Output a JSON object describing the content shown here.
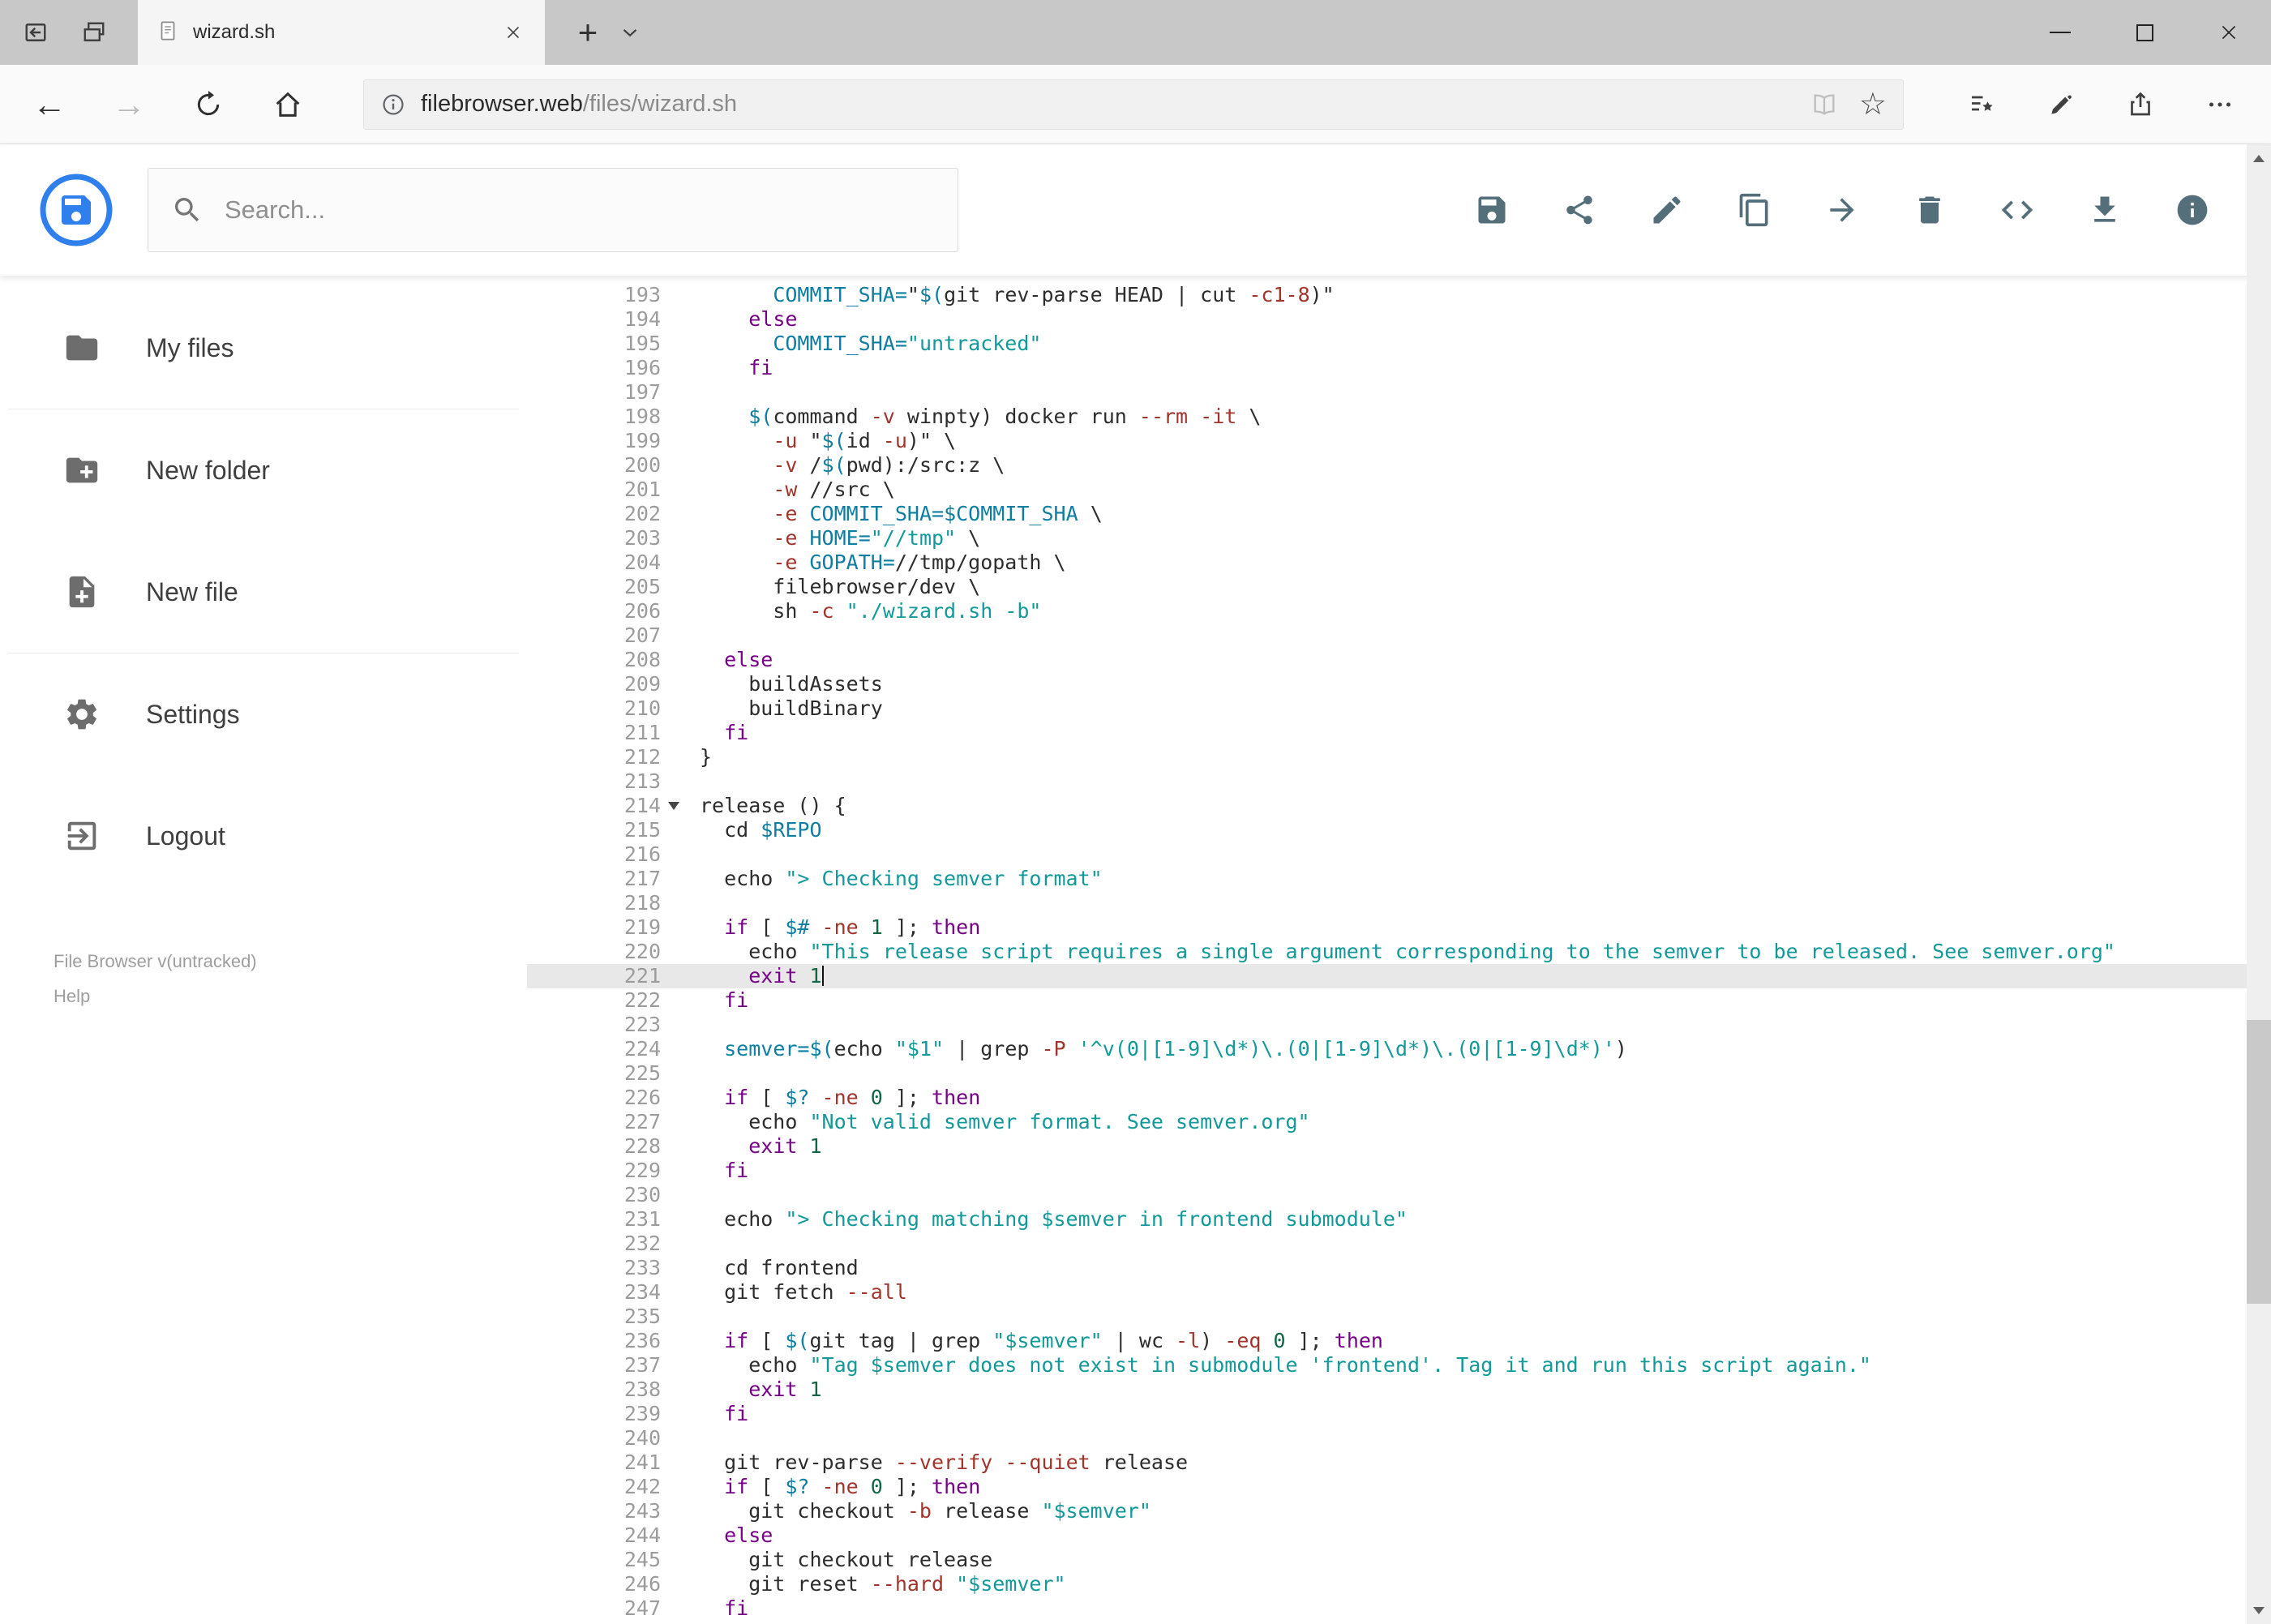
{
  "browser": {
    "tab_title": "wizard.sh",
    "new_tab_label": "+",
    "url_host": "filebrowser.web",
    "url_path": "/files/wizard.sh"
  },
  "header": {
    "search_placeholder": "Search...",
    "action_icons": [
      "save",
      "share",
      "rename",
      "copy",
      "move",
      "delete",
      "edit-source",
      "download",
      "info"
    ]
  },
  "sidebar": {
    "items": [
      {
        "label": "My files",
        "icon": "folder"
      },
      {
        "label": "New folder",
        "icon": "new-folder"
      },
      {
        "label": "New file",
        "icon": "new-file"
      },
      {
        "label": "Settings",
        "icon": "settings"
      },
      {
        "label": "Logout",
        "icon": "logout"
      }
    ],
    "version_text": "File Browser v(untracked)",
    "help_label": "Help"
  },
  "editor": {
    "first_line_number": 193,
    "active_line": 221,
    "cursor_line": 221,
    "fold_line": 214,
    "lines": [
      "      COMMIT_SHA=\"$(git rev-parse HEAD | cut -c1-8)\"",
      "    else",
      "      COMMIT_SHA=\"untracked\"",
      "    fi",
      "",
      "    $(command -v winpty) docker run --rm -it \\",
      "      -u \"$(id -u)\" \\",
      "      -v /$(pwd):/src:z \\",
      "      -w //src \\",
      "      -e COMMIT_SHA=$COMMIT_SHA \\",
      "      -e HOME=\"//tmp\" \\",
      "      -e GOPATH=//tmp/gopath \\",
      "      filebrowser/dev \\",
      "      sh -c \"./wizard.sh -b\"",
      "",
      "  else",
      "    buildAssets",
      "    buildBinary",
      "  fi",
      "}",
      "",
      "release () {",
      "  cd $REPO",
      "",
      "  echo \"> Checking semver format\"",
      "",
      "  if [ $# -ne 1 ]; then",
      "    echo \"This release script requires a single argument corresponding to the semver to be released. See semver.org\"",
      "    exit 1",
      "  fi",
      "",
      "  semver=$(echo \"$1\" | grep -P '^v(0|[1-9]\\d*)\\.(0|[1-9]\\d*)\\.(0|[1-9]\\d*)')",
      "",
      "  if [ $? -ne 0 ]; then",
      "    echo \"Not valid semver format. See semver.org\"",
      "    exit 1",
      "  fi",
      "",
      "  echo \"> Checking matching $semver in frontend submodule\"",
      "",
      "  cd frontend",
      "  git fetch --all",
      "",
      "  if [ $(git tag | grep \"$semver\" | wc -l) -eq 0 ]; then",
      "    echo \"Tag $semver does not exist in submodule 'frontend'. Tag it and run this script again.\"",
      "    exit 1",
      "  fi",
      "",
      "  git rev-parse --verify --quiet release",
      "  if [ $? -ne 0 ]; then",
      "    git checkout -b release \"$semver\"",
      "  else",
      "    git checkout release",
      "    git reset --hard \"$semver\"",
      "  fi"
    ]
  },
  "colors": {
    "accent_blue": "#2f80ed",
    "icon_slate": "#546e7a",
    "keyword": "#770088",
    "string": "#139999",
    "variable": "#0e7ea3",
    "flag": "#a1352c",
    "number": "#116644",
    "active_line_bg": "#e8e8e8"
  }
}
